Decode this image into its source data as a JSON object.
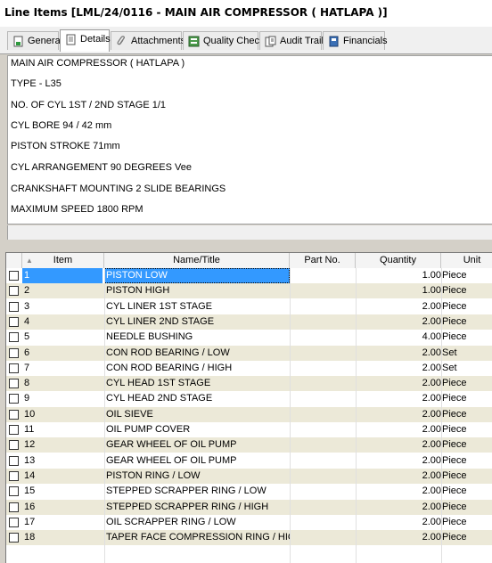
{
  "window": {
    "title": "Line Items [LML/24/0116 - MAIN AIR COMPRESSOR ( HATLAPA )]"
  },
  "tabs": [
    {
      "label": "General",
      "icon": "document-icon"
    },
    {
      "label": "Details",
      "icon": "page-icon",
      "active": true
    },
    {
      "label": "Attachments",
      "icon": "paperclip-icon"
    },
    {
      "label": "Quality Check",
      "icon": "checklist-icon"
    },
    {
      "label": "Audit Trail",
      "icon": "audit-icon"
    },
    {
      "label": "Financials",
      "icon": "book-icon"
    }
  ],
  "details": {
    "lines": [
      "MAIN AIR COMPRESSOR ( HATLAPA )",
      "TYPE - L35",
      "NO. OF CYL 1ST / 2ND STAGE 1/1",
      "CYL BORE 94 / 42 mm",
      "PISTON STROKE 71mm",
      "CYL ARRANGEMENT 90 DEGREES Vee",
      "CRANKSHAFT MOUNTING 2 SLIDE BEARINGS",
      "MAXIMUM SPEED 1800 RPM"
    ]
  },
  "grid": {
    "columns": {
      "item": "Item",
      "name": "Name/Title",
      "part": "Part No.",
      "quantity": "Quantity",
      "unit": "Unit"
    },
    "rows": [
      {
        "item": "1",
        "name": "PISTON LOW",
        "part": "",
        "quantity": "1.00",
        "unit": "Piece",
        "selected": true
      },
      {
        "item": "2",
        "name": "PISTON HIGH",
        "part": "",
        "quantity": "1.00",
        "unit": "Piece"
      },
      {
        "item": "3",
        "name": "CYL LINER 1ST STAGE",
        "part": "",
        "quantity": "2.00",
        "unit": "Piece"
      },
      {
        "item": "4",
        "name": "CYL LINER 2ND STAGE",
        "part": "",
        "quantity": "2.00",
        "unit": "Piece"
      },
      {
        "item": "5",
        "name": "NEEDLE BUSHING",
        "part": "",
        "quantity": "4.00",
        "unit": "Piece"
      },
      {
        "item": "6",
        "name": "CON ROD BEARING / LOW",
        "part": "",
        "quantity": "2.00",
        "unit": "Set"
      },
      {
        "item": "7",
        "name": "CON ROD BEARING / HIGH",
        "part": "",
        "quantity": "2.00",
        "unit": "Set"
      },
      {
        "item": "8",
        "name": "CYL HEAD 1ST STAGE",
        "part": "",
        "quantity": "2.00",
        "unit": "Piece"
      },
      {
        "item": "9",
        "name": "CYL HEAD 2ND STAGE",
        "part": "",
        "quantity": "2.00",
        "unit": "Piece"
      },
      {
        "item": "10",
        "name": "OIL SIEVE",
        "part": "",
        "quantity": "2.00",
        "unit": "Piece"
      },
      {
        "item": "11",
        "name": "OIL PUMP COVER",
        "part": "",
        "quantity": "2.00",
        "unit": "Piece"
      },
      {
        "item": "12",
        "name": "GEAR WHEEL OF OIL PUMP",
        "part": "",
        "quantity": "2.00",
        "unit": "Piece"
      },
      {
        "item": "13",
        "name": "GEAR WHEEL OF OIL PUMP",
        "part": "",
        "quantity": "2.00",
        "unit": "Piece"
      },
      {
        "item": "14",
        "name": "PISTON RING / LOW",
        "part": "",
        "quantity": "2.00",
        "unit": "Piece"
      },
      {
        "item": "15",
        "name": "STEPPED SCRAPPER RING / LOW",
        "part": "",
        "quantity": "2.00",
        "unit": "Piece"
      },
      {
        "item": "16",
        "name": "STEPPED SCRAPPER RING / HIGH",
        "part": "",
        "quantity": "2.00",
        "unit": "Piece"
      },
      {
        "item": "17",
        "name": "OIL SCRAPPER RING / LOW",
        "part": "",
        "quantity": "2.00",
        "unit": "Piece"
      },
      {
        "item": "18",
        "name": "TAPER FACE COMPRESSION RING / HIGH",
        "part": "",
        "quantity": "2.00",
        "unit": "Piece"
      }
    ]
  }
}
